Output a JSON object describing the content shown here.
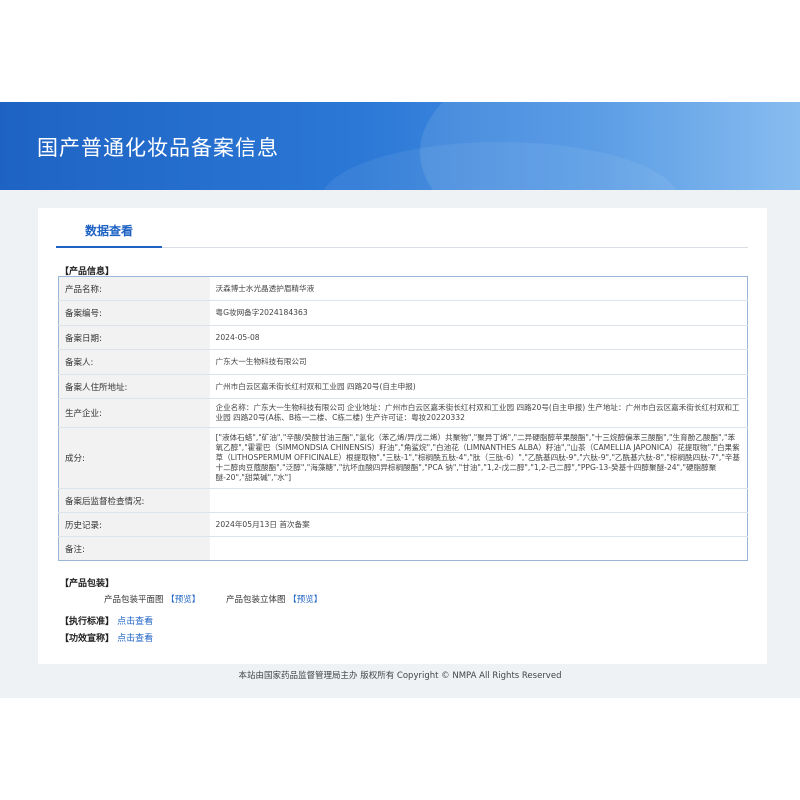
{
  "banner": {
    "title": "国产普通化妆品备案信息"
  },
  "tab": {
    "label": "数据查看"
  },
  "product_info": {
    "section_label": "【产品信息】",
    "rows": [
      {
        "key": "产品名称:",
        "value": "沃森博士水光晶透护眉精华液"
      },
      {
        "key": "备案编号:",
        "value": "粤G妆网备字2024184363"
      },
      {
        "key": "备案日期:",
        "value": "2024-05-08"
      },
      {
        "key": "备案人:",
        "value": "广东大一生物科技有限公司"
      },
      {
        "key": "备案人住所地址:",
        "value": "广州市白云区嘉禾街长红村双和工业园 四路20号(自主申报)"
      },
      {
        "key": "生产企业:",
        "value": "企业名称：广东大一生物科技有限公司 企业地址：广州市白云区嘉禾街长红村双和工业园 四路20号(自主申报) 生产地址：广州市白云区嘉禾街长红村双和工业园 四路20号(A栋、B栋一二楼、C栋二楼) 生产许可证：粤妆20220332"
      },
      {
        "key": "成分:",
        "value": "[\"液体石蜡\",\"矿油\",\"辛酸/癸酸甘油三酯\",\"氢化（苯乙烯/异戊二烯）共聚物\",\"聚异丁烯\",\"二异硬脂醇苹果酸酯\",\"十三烷醇偏苯三酸酯\",\"生育酚乙酸酯\",\"苯氧乙醇\",\"霍霍巴（SIMMONDSIA CHINENSIS）籽油\",\"角鲨烷\",\"白池花（LIMNANTHES ALBA）籽油\",\"山茶（CAMELLIA JAPONICA）花提取物\",\"白果紫草（LITHOSPERMUM OFFICINALE）根提取物\",\"三肽-1\",\"棕榈酰五肽-4\",\"肽（三肽-6）\",\"乙酰基四肽-9\",\"六肽-9\",\"乙酰基六肽-8\",\"棕榈酰四肽-7\",\"辛基十二醇肉豆蔻酸酯\",\"泛醇\",\"海藻糖\",\"抗坏血酸四异棕榈酸酯\",\"PCA 钠\",\"甘油\",\"1,2-戊二醇\",\"1,2-己二醇\",\"PPG-13-癸基十四醇聚醚-24\",\"硬脂醇聚醚-20\",\"甜菜碱\",\"水\"]"
      },
      {
        "key": "备案后监督检查情况:",
        "value": ""
      },
      {
        "key": "历史记录:",
        "value": "2024年05月13日 首次备案"
      },
      {
        "key": "备注:",
        "value": ""
      }
    ]
  },
  "packaging": {
    "section_label": "【产品包装】",
    "flat_label": "产品包装平面图",
    "flat_link": "【预览】",
    "stereo_label": "产品包装立体图",
    "stereo_link": "【预览】"
  },
  "standard": {
    "label": "【执行标准】",
    "link": "点击查看"
  },
  "efficacy": {
    "label": "【功效宣称】",
    "link": "点击查看"
  },
  "footer": {
    "text": "本站由国家药品监督管理局主办 版权所有 Copyright © NMPA All Rights Reserved"
  },
  "colors": {
    "brand": "#1e63c4",
    "label_bg": "#f2f2f2",
    "page_bg": "#eef2f5"
  }
}
